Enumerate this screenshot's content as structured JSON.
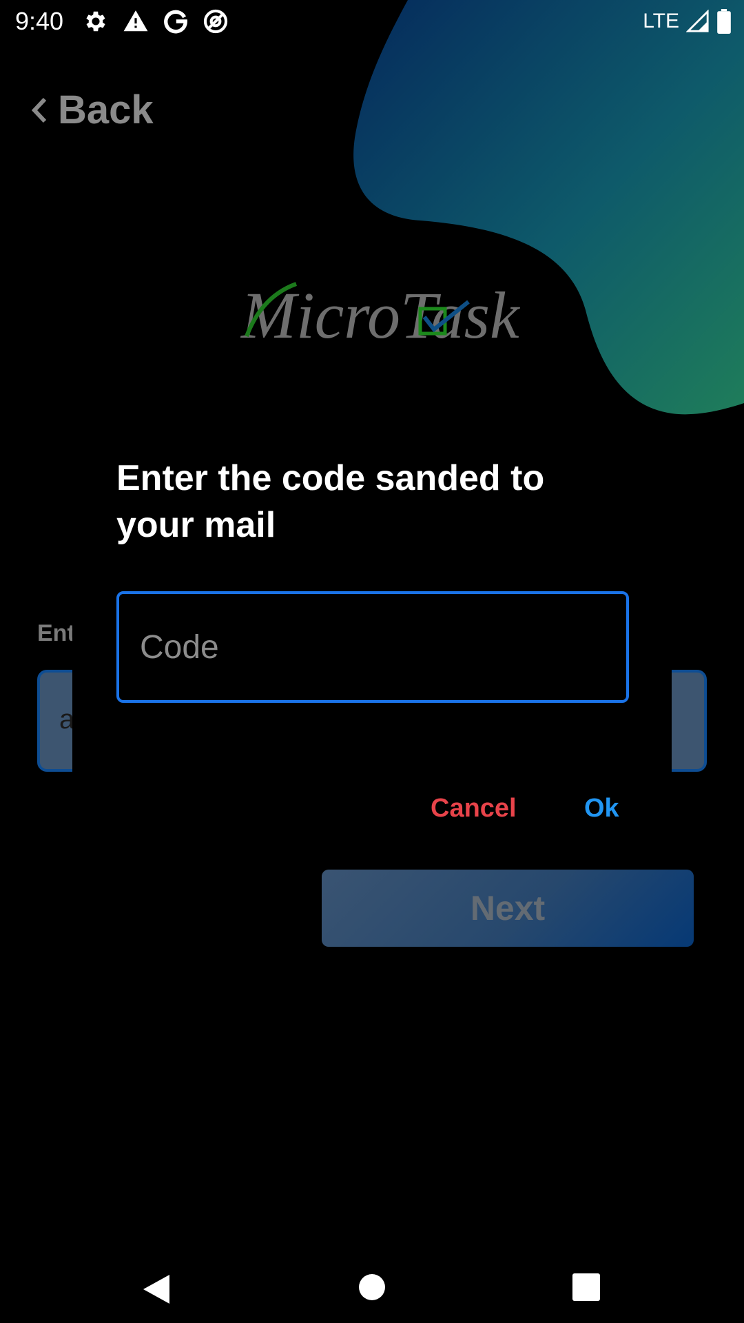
{
  "status_bar": {
    "time": "9:40",
    "icons": [
      "settings-icon",
      "warning-icon",
      "google-icon",
      "at-sign-icon"
    ],
    "network": "LTE",
    "right_icons": [
      "signal-icon",
      "battery-icon"
    ]
  },
  "header": {
    "back_label": "Back",
    "back_icon": "chevron-left-icon"
  },
  "logo": {
    "text": "MicroTask"
  },
  "background_form": {
    "label": "Ent",
    "field_value": "a",
    "next_label": "Next"
  },
  "dialog": {
    "title": "Enter the code sanded to your mail",
    "input_placeholder": "Code",
    "input_value": "",
    "cancel_label": "Cancel",
    "ok_label": "Ok"
  },
  "nav_bar": {
    "icons": [
      "back-triangle-icon",
      "home-circle-icon",
      "recents-square-icon"
    ]
  },
  "colors": {
    "accent": "#1a73e8",
    "cancel": "#e8434a",
    "ok": "#2196f3",
    "blob_start": "#053060",
    "blob_end": "#1e7a5c"
  }
}
